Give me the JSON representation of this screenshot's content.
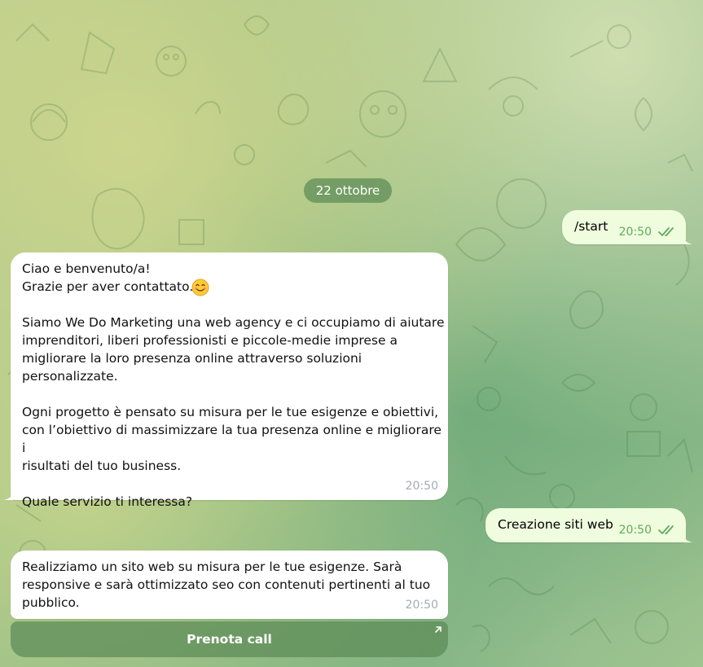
{
  "chat": {
    "date_label": "22 ottobre",
    "messages": [
      {
        "direction": "out",
        "text": "/start",
        "time": "20:50",
        "status_icon": "double-check-icon"
      },
      {
        "direction": "in",
        "text": "Ciao e benvenuto/a!\nGrazie per aver contattato.\n\nSiamo We Do Marketing una web agency e ci occupiamo di aiutare\nimprenditori, liberi professionisti e piccole-medie imprese a\nmigliorare la loro presenza online attraverso soluzioni\npersonalizzate.\n\nOgni progetto è pensato su misura per le tue esigenze e obiettivi,\ncon l’obiettivo di massimizzare la tua presenza online e migliorare i\nrisultati del tuo business.\n\nQuale servizio ti interessa?",
        "emoji": "smiling-face-emoji",
        "time": "20:50"
      },
      {
        "direction": "out",
        "text": "Creazione siti web",
        "time": "20:50",
        "status_icon": "double-check-icon"
      },
      {
        "direction": "in",
        "text": "Realizziamo un sito web su misura per le tue esigenze. Sarà\nresponsive e sarà ottimizzato seo con contenuti pertinenti al tuo\npubblico.",
        "time": "20:50"
      }
    ],
    "inline_button": {
      "label": "Prenota call",
      "icon": "external-link-arrow-icon"
    }
  },
  "colors": {
    "outgoing_bubble": "#effdde",
    "incoming_bubble": "#ffffff",
    "outgoing_time": "#5faa5c",
    "incoming_time": "#a3acb4",
    "service_pill": "#5c8a56"
  }
}
